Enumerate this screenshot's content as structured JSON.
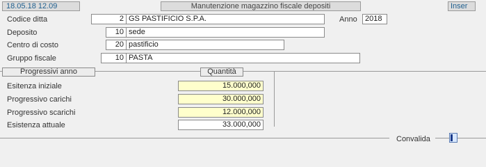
{
  "header": {
    "datetime": "18.05.18 12.09",
    "title": "Manutenzione magazzino fiscale depositi",
    "mode": "Inser"
  },
  "form": {
    "codice_ditta": {
      "label": "Codice ditta",
      "code": "2",
      "name": "GS PASTIFICIO S.P.A."
    },
    "anno": {
      "label": "Anno",
      "value": "2018"
    },
    "deposito": {
      "label": "Deposito",
      "code": "10",
      "name": "sede"
    },
    "centro_di_costo": {
      "label": "Centro di costo",
      "code": "20",
      "name": "pastificio"
    },
    "gruppo_fiscale": {
      "label": "Gruppo fiscale",
      "code": "10",
      "name": "PASTA"
    }
  },
  "progressivi": {
    "header": "Progressivi anno",
    "column_header": "Quantità",
    "rows": [
      {
        "label": "Esitenza iniziale",
        "value": "15.000,000",
        "highlight": true
      },
      {
        "label": "Progressivo carichi",
        "value": "30.000,000",
        "highlight": true
      },
      {
        "label": "Progressivo scarichi",
        "value": "12.000,000",
        "highlight": true
      },
      {
        "label": "Esistenza attuale",
        "value": "33.000,000",
        "highlight": false
      }
    ]
  },
  "footer": {
    "convalida_label": "Convalida"
  },
  "colors": {
    "background": "#f0f0f0",
    "field_background": "#ffffff",
    "editable_highlight": "#ffffcc",
    "header_text_accent": "#1f5f8f"
  }
}
